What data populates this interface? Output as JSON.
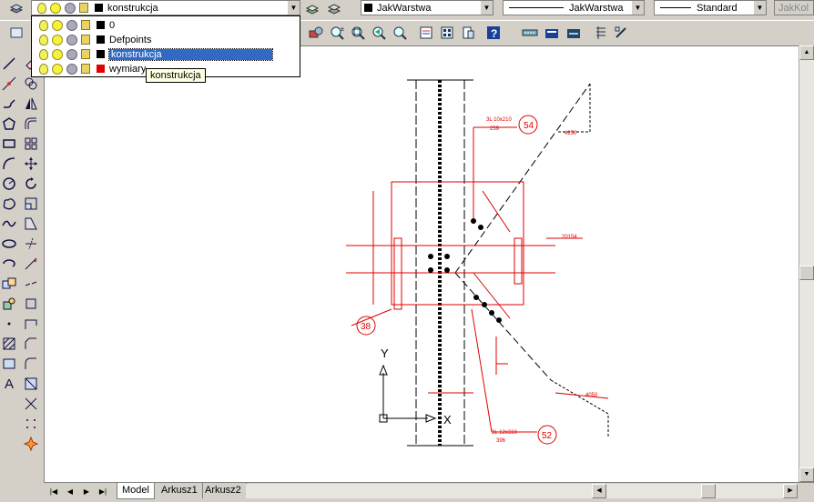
{
  "toolbar": {
    "layer_combo_value": "konstrukcja",
    "color_combo_value": "JakWarstwa",
    "linetype_combo_value": "JakWarstwa",
    "lineweight_combo_value": "Standard",
    "plotstyle_combo_value": "JakKol"
  },
  "layer_dropdown": {
    "items": [
      {
        "name": "0",
        "color": "#000000",
        "selected": false
      },
      {
        "name": "Defpoints",
        "color": "#000000",
        "selected": false
      },
      {
        "name": "konstrukcja",
        "color": "#000000",
        "selected": true
      },
      {
        "name": "wymiary",
        "color": "#e00000",
        "selected": false
      }
    ],
    "tooltip": "konstrukcja"
  },
  "tabs": [
    "Model",
    "Arkusz1",
    "Arkusz2"
  ],
  "drawing": {
    "labels": {
      "callout1": "54",
      "callout2": "38",
      "callout3": "52",
      "top_note": "3L 10x210",
      "top_note2": "259",
      "bottom_note": "3L 12x310",
      "bottom_note2": "396",
      "elev": "20154",
      "dim_top": "4250",
      "dim_bot": "4050",
      "ucs_y": "Y",
      "ucs_x": "X"
    }
  },
  "colors": {
    "accent_select": "#316ac5",
    "drawing_red": "#e00000"
  }
}
